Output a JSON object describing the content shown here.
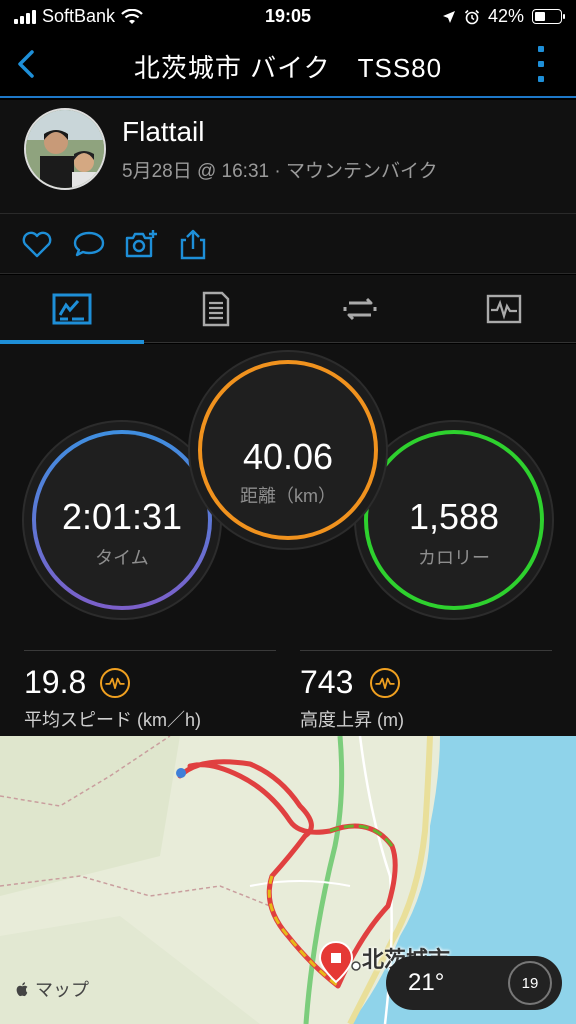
{
  "status_bar": {
    "carrier": "SoftBank",
    "time": "19:05",
    "battery": "42%",
    "battery_level": 0.42
  },
  "nav": {
    "title": "北茨城市 バイク　TSS80"
  },
  "activity": {
    "user_name": "Flattail",
    "meta": "5月28日 @ 16:31 · マウンテンバイク"
  },
  "actions": [
    "like-icon",
    "comment-icon",
    "add-photo-icon",
    "share-icon"
  ],
  "tabs": [
    "stats-tab-icon",
    "details-tab-icon",
    "laps-tab-icon",
    "charts-tab-icon"
  ],
  "stats": {
    "distance": {
      "value": "40.06",
      "label": "距離（km）",
      "color": "#f0921e"
    },
    "time": {
      "value": "2:01:31",
      "label": "タイム",
      "color": "#3f8fe0"
    },
    "calories": {
      "value": "1,588",
      "label": "カロリー",
      "color": "#2ed12e"
    },
    "avg_speed": {
      "value": "19.8",
      "label": "平均スピード (km／h)"
    },
    "elevation": {
      "value": "743",
      "label": "高度上昇 (m)"
    }
  },
  "map": {
    "brand": "マップ",
    "city": "北茨城市",
    "temperature": "21°",
    "wind": "19"
  }
}
